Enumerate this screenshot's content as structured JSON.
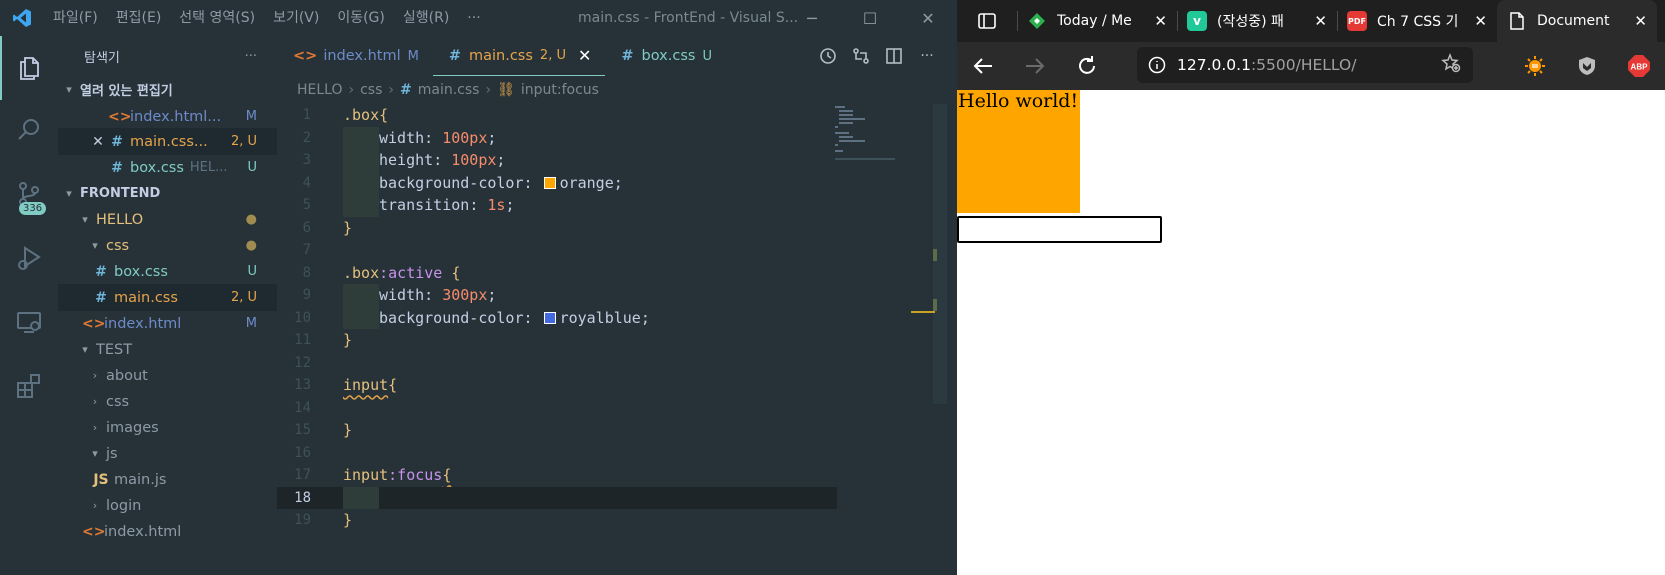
{
  "vscode": {
    "menu": [
      "파일(F)",
      "편집(E)",
      "선택 영역(S)",
      "보기(V)",
      "이동(G)",
      "실행(R)",
      "···"
    ],
    "window_title": "main.css - FrontEnd - Visual S...",
    "activity": {
      "scm_badge": "336"
    },
    "explorer": {
      "title": "탐색기",
      "more": "···",
      "open_editors_header": "열려 있는 편집기",
      "open_editors": [
        {
          "name": "index.html...",
          "badge": "M"
        },
        {
          "name": "main.css...",
          "badge": "2, U"
        },
        {
          "name": "box.css",
          "desc": "HEL...",
          "badge": "U"
        }
      ],
      "workspace_header": "FRONTEND",
      "tree": {
        "hello": "HELLO",
        "css": "css",
        "box_css": "box.css",
        "box_css_badge": "U",
        "main_css": "main.css",
        "main_css_badge": "2, U",
        "index_html": "index.html",
        "index_html_badge": "M",
        "test": "TEST",
        "about": "about",
        "css2": "css",
        "images": "images",
        "js": "js",
        "js_icon": "JS",
        "main_js": "main.js",
        "login": "login",
        "index_html2": "index.html"
      }
    },
    "tabs": [
      {
        "label": "index.html",
        "state": "M"
      },
      {
        "label": "main.css",
        "state": "2, U"
      },
      {
        "label": "box.css",
        "state": "U"
      }
    ],
    "breadcrumb": [
      "HELLO",
      "css",
      "main.css",
      "input:focus"
    ],
    "code": {
      "line_numbers": [
        "1",
        "2",
        "3",
        "4",
        "5",
        "6",
        "7",
        "8",
        "9",
        "10",
        "11",
        "12",
        "13",
        "14",
        "15",
        "16",
        "17",
        "18",
        "19"
      ],
      "l1_sel": ".box",
      "brace_open": "{",
      "brace_close": "}",
      "width_prop": "width",
      "width_val": "100px",
      "height_prop": "height",
      "height_val": "100px",
      "bg_prop": "background-color",
      "bg_val1": "orange",
      "trans_prop": "transition",
      "trans_val": "1s",
      "l8_sel": ".box",
      "l8_pseudo": ":active",
      "width_val2": "300px",
      "bg_val2": "royalblue",
      "l13_sel": "input",
      "l17_sel": "input",
      "l17_pseudo": ":focus",
      "colors": {
        "orange": "#ffa500",
        "royalblue": "#4169e1"
      }
    }
  },
  "browser": {
    "tabs": [
      {
        "title": "Today / Me",
        "icon": "feedly-icon"
      },
      {
        "title": "(작성중) 패",
        "icon": "velog-icon"
      },
      {
        "title": "Ch 7 CSS 기",
        "icon": "pdf-icon"
      },
      {
        "title": "Document",
        "icon": "page-icon"
      }
    ],
    "url_host": "127.0.0.1",
    "url_rest": ":5500/HELLO/",
    "extensions": [
      "sun-extension-icon",
      "shield-extension-icon",
      "adblock-icon"
    ],
    "adblock_label": "ABP",
    "page": {
      "box_text": "Hello world!",
      "box_color": "#ffa500"
    }
  }
}
